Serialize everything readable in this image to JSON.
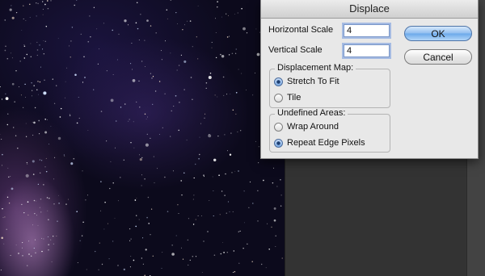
{
  "dialog": {
    "title": "Displace",
    "horizontal_scale": {
      "label": "Horizontal Scale",
      "value": "4"
    },
    "vertical_scale": {
      "label": "Vertical Scale",
      "value": "4"
    },
    "ok_label": "OK",
    "cancel_label": "Cancel",
    "displacement_map": {
      "title": "Displacement Map:",
      "options": [
        {
          "label": "Stretch To Fit",
          "selected": true
        },
        {
          "label": "Tile",
          "selected": false
        }
      ]
    },
    "undefined_areas": {
      "title": "Undefined Areas:",
      "options": [
        {
          "label": "Wrap Around",
          "selected": false
        },
        {
          "label": "Repeat Edge Pixels",
          "selected": true
        }
      ]
    }
  },
  "colors": {
    "dialog_bg": "#e8e8e8",
    "default_button": "#6aa8ea",
    "photo_bg": "#0c0a1c",
    "panel_bg": "#333333"
  }
}
